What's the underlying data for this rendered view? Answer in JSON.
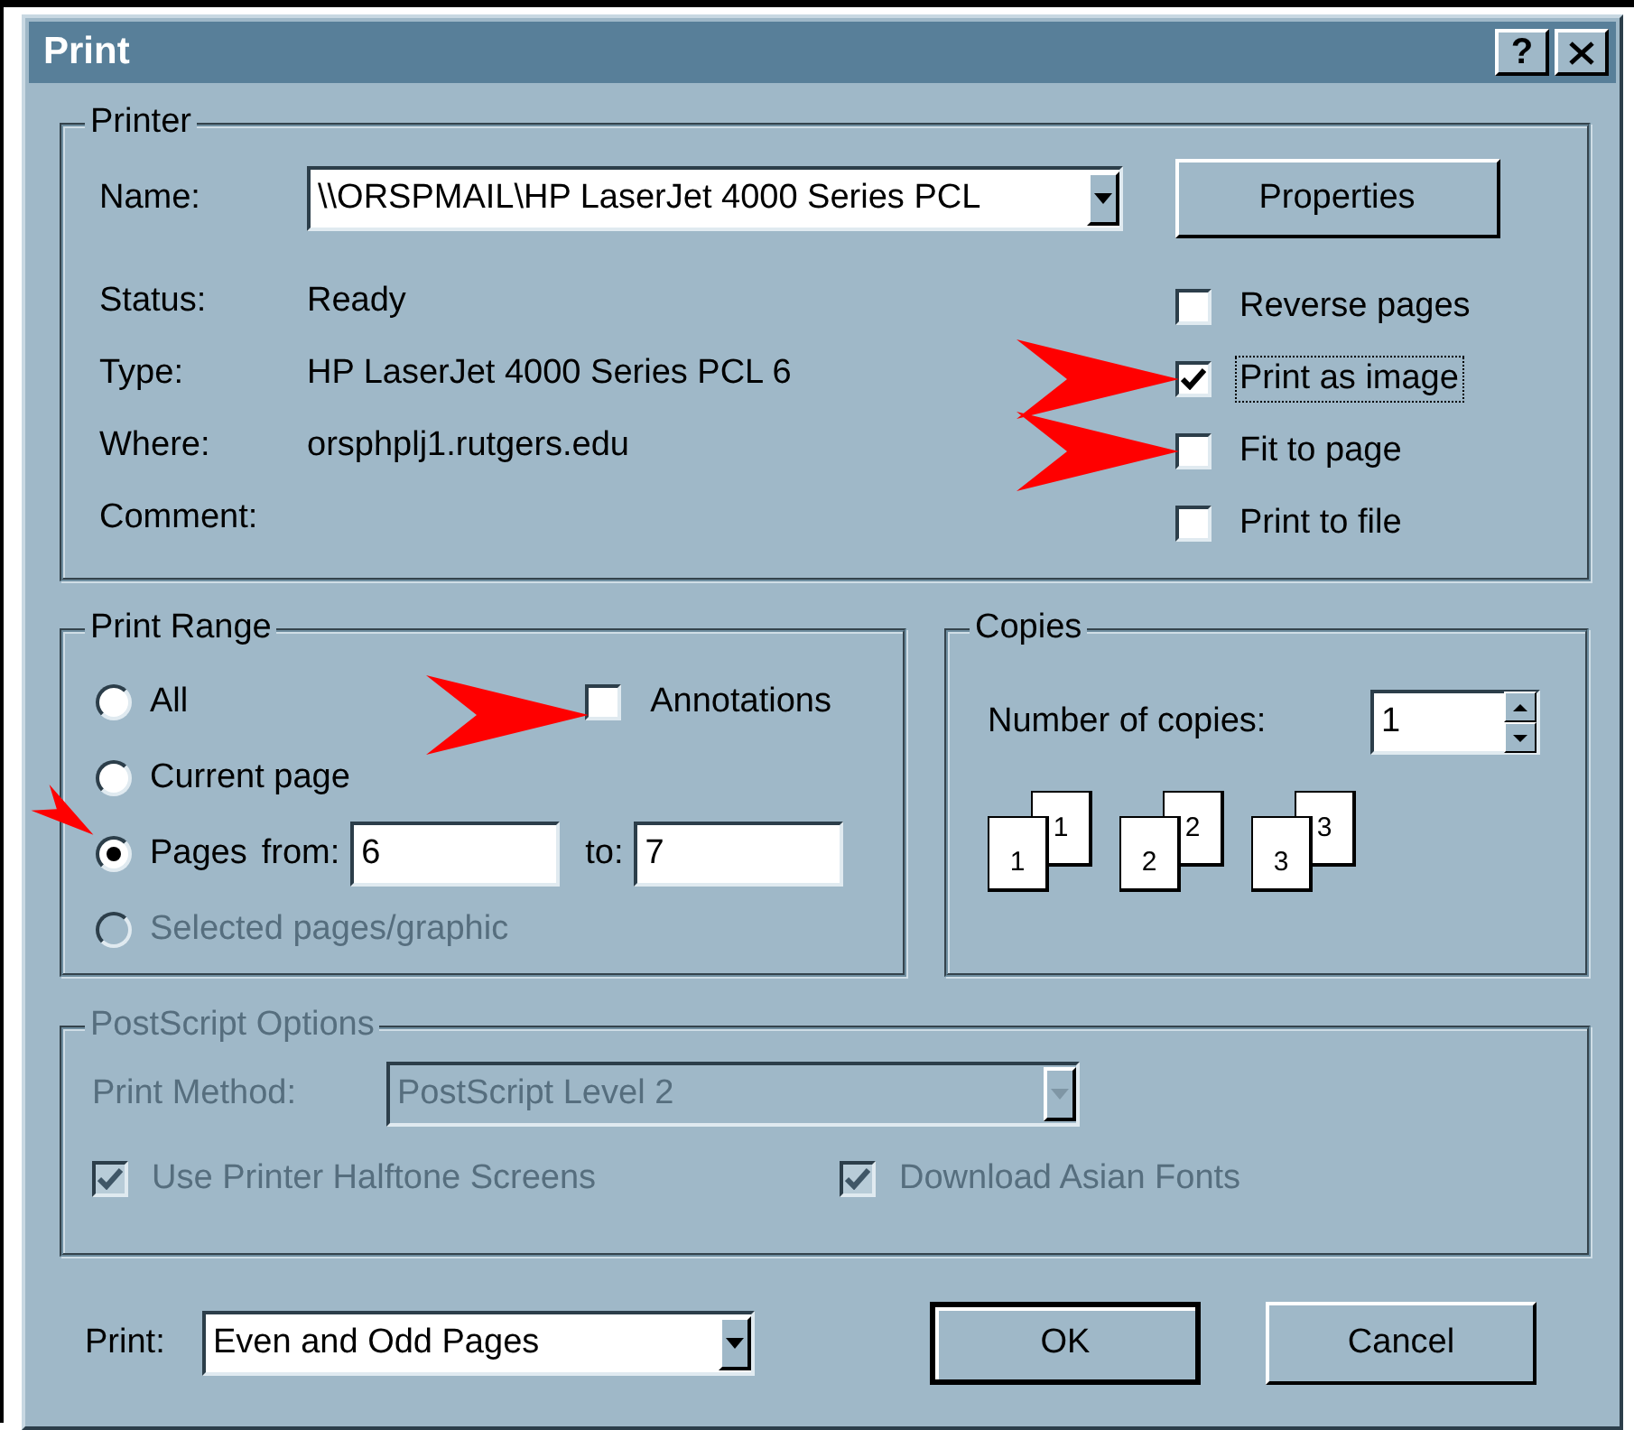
{
  "window": {
    "title": "Print",
    "help_button": "?"
  },
  "printer": {
    "title": "Printer",
    "name_label": "Name:",
    "name_value": "\\\\ORSPMAIL\\HP LaserJet 4000 Series PCL",
    "properties_button": "Properties",
    "info": [
      {
        "label": "Status:",
        "value": "Ready"
      },
      {
        "label": "Type:",
        "value": "HP LaserJet 4000 Series PCL 6"
      },
      {
        "label": "Where:",
        "value": "orsphplj1.rutgers.edu"
      },
      {
        "label": "Comment:"
      }
    ],
    "options": [
      {
        "label": "Reverse pages",
        "checked": false,
        "focused": false,
        "arrowed": false
      },
      {
        "label": "Print as image",
        "checked": true,
        "focused": true,
        "arrowed": true
      },
      {
        "label": "Fit to page",
        "checked": false,
        "focused": false,
        "arrowed": true
      },
      {
        "label": "Print to file",
        "checked": false,
        "focused": false,
        "arrowed": false
      }
    ]
  },
  "print_range": {
    "title": "Print Range",
    "radios": [
      {
        "label": "All",
        "selected": false,
        "disabled": false,
        "arrowed": false
      },
      {
        "label": "Current page",
        "selected": false,
        "disabled": false,
        "arrowed": false
      },
      {
        "label": "Pages",
        "selected": true,
        "disabled": false,
        "arrowed": true
      },
      {
        "label": "Selected pages/graphic",
        "selected": false,
        "disabled": true,
        "arrowed": false
      }
    ],
    "annotations": {
      "label": "Annotations",
      "checked": false,
      "arrowed": true
    },
    "from_label": "from:",
    "from_value": "6",
    "to_label": "to:",
    "to_value": "7"
  },
  "copies": {
    "title": "Copies",
    "label": "Number of copies:",
    "value": "1",
    "pages": [
      {
        "back": "1",
        "front": "1"
      },
      {
        "back": "2",
        "front": "2"
      },
      {
        "back": "3",
        "front": "3"
      }
    ]
  },
  "postscript": {
    "title": "PostScript Options",
    "disabled": true,
    "method_label": "Print Method:",
    "method_value": "PostScript Level 2",
    "checkboxes": [
      {
        "label": "Use Printer Halftone Screens",
        "checked": true
      },
      {
        "label": "Download Asian Fonts",
        "checked": true
      }
    ]
  },
  "footer": {
    "print_label": "Print:",
    "print_value": "Even and Odd Pages",
    "buttons": [
      {
        "label": "OK",
        "default": true
      },
      {
        "label": "Cancel",
        "default": false
      }
    ]
  }
}
